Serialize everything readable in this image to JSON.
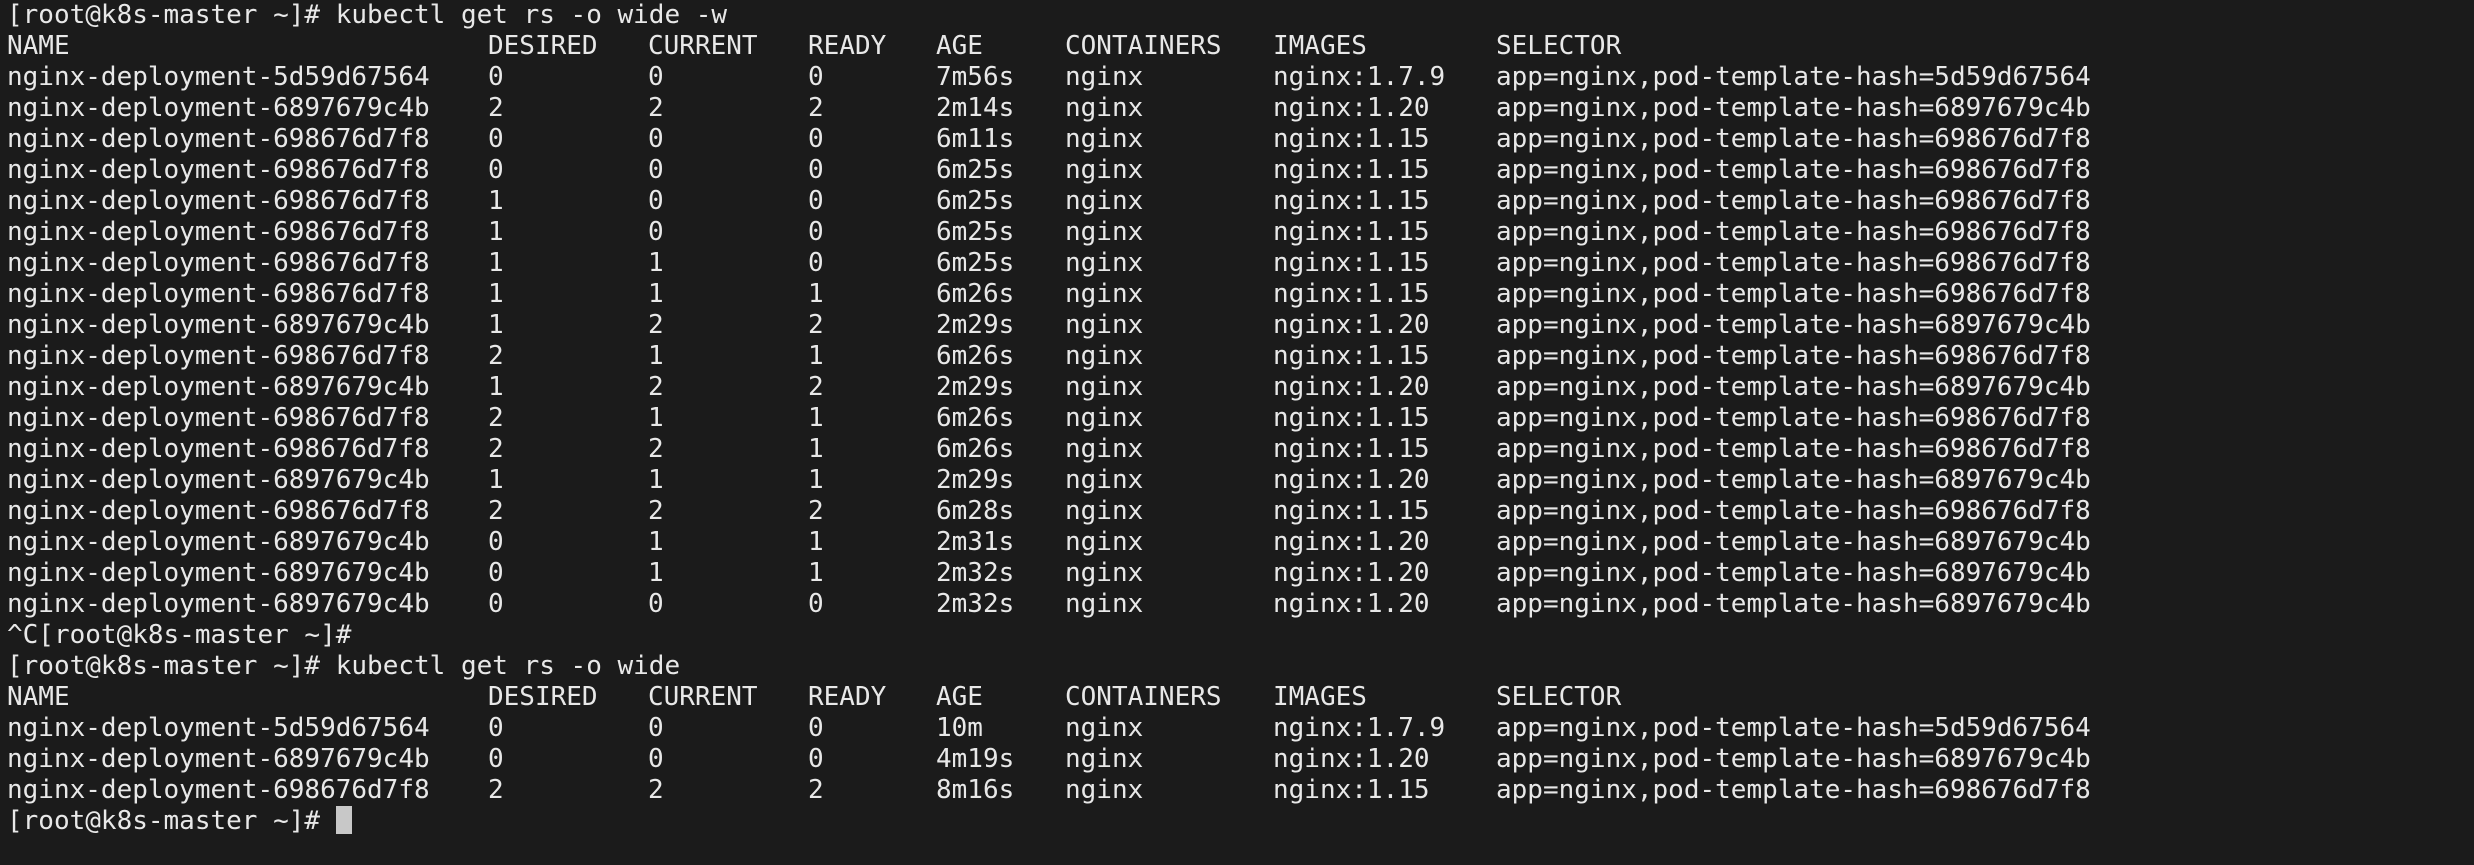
{
  "session1": {
    "prompt": "[root@k8s-master ~]# ",
    "command": "kubectl get rs -o wide -w",
    "headers": [
      "NAME",
      "DESIRED",
      "CURRENT",
      "READY",
      "AGE",
      "CONTAINERS",
      "IMAGES",
      "SELECTOR"
    ],
    "rows": [
      [
        "nginx-deployment-5d59d67564",
        "0",
        "0",
        "0",
        "7m56s",
        "nginx",
        "nginx:1.7.9",
        "app=nginx,pod-template-hash=5d59d67564"
      ],
      [
        "nginx-deployment-6897679c4b",
        "2",
        "2",
        "2",
        "2m14s",
        "nginx",
        "nginx:1.20",
        "app=nginx,pod-template-hash=6897679c4b"
      ],
      [
        "nginx-deployment-698676d7f8",
        "0",
        "0",
        "0",
        "6m11s",
        "nginx",
        "nginx:1.15",
        "app=nginx,pod-template-hash=698676d7f8"
      ],
      [
        "nginx-deployment-698676d7f8",
        "0",
        "0",
        "0",
        "6m25s",
        "nginx",
        "nginx:1.15",
        "app=nginx,pod-template-hash=698676d7f8"
      ],
      [
        "nginx-deployment-698676d7f8",
        "1",
        "0",
        "0",
        "6m25s",
        "nginx",
        "nginx:1.15",
        "app=nginx,pod-template-hash=698676d7f8"
      ],
      [
        "nginx-deployment-698676d7f8",
        "1",
        "0",
        "0",
        "6m25s",
        "nginx",
        "nginx:1.15",
        "app=nginx,pod-template-hash=698676d7f8"
      ],
      [
        "nginx-deployment-698676d7f8",
        "1",
        "1",
        "0",
        "6m25s",
        "nginx",
        "nginx:1.15",
        "app=nginx,pod-template-hash=698676d7f8"
      ],
      [
        "nginx-deployment-698676d7f8",
        "1",
        "1",
        "1",
        "6m26s",
        "nginx",
        "nginx:1.15",
        "app=nginx,pod-template-hash=698676d7f8"
      ],
      [
        "nginx-deployment-6897679c4b",
        "1",
        "2",
        "2",
        "2m29s",
        "nginx",
        "nginx:1.20",
        "app=nginx,pod-template-hash=6897679c4b"
      ],
      [
        "nginx-deployment-698676d7f8",
        "2",
        "1",
        "1",
        "6m26s",
        "nginx",
        "nginx:1.15",
        "app=nginx,pod-template-hash=698676d7f8"
      ],
      [
        "nginx-deployment-6897679c4b",
        "1",
        "2",
        "2",
        "2m29s",
        "nginx",
        "nginx:1.20",
        "app=nginx,pod-template-hash=6897679c4b"
      ],
      [
        "nginx-deployment-698676d7f8",
        "2",
        "1",
        "1",
        "6m26s",
        "nginx",
        "nginx:1.15",
        "app=nginx,pod-template-hash=698676d7f8"
      ],
      [
        "nginx-deployment-698676d7f8",
        "2",
        "2",
        "1",
        "6m26s",
        "nginx",
        "nginx:1.15",
        "app=nginx,pod-template-hash=698676d7f8"
      ],
      [
        "nginx-deployment-6897679c4b",
        "1",
        "1",
        "1",
        "2m29s",
        "nginx",
        "nginx:1.20",
        "app=nginx,pod-template-hash=6897679c4b"
      ],
      [
        "nginx-deployment-698676d7f8",
        "2",
        "2",
        "2",
        "6m28s",
        "nginx",
        "nginx:1.15",
        "app=nginx,pod-template-hash=698676d7f8"
      ],
      [
        "nginx-deployment-6897679c4b",
        "0",
        "1",
        "1",
        "2m31s",
        "nginx",
        "nginx:1.20",
        "app=nginx,pod-template-hash=6897679c4b"
      ],
      [
        "nginx-deployment-6897679c4b",
        "0",
        "1",
        "1",
        "2m32s",
        "nginx",
        "nginx:1.20",
        "app=nginx,pod-template-hash=6897679c4b"
      ],
      [
        "nginx-deployment-6897679c4b",
        "0",
        "0",
        "0",
        "2m32s",
        "nginx",
        "nginx:1.20",
        "app=nginx,pod-template-hash=6897679c4b"
      ]
    ]
  },
  "interrupt_line": "^C[root@k8s-master ~]#",
  "session2": {
    "prompt": "[root@k8s-master ~]# ",
    "command": "kubectl get rs -o wide",
    "headers": [
      "NAME",
      "DESIRED",
      "CURRENT",
      "READY",
      "AGE",
      "CONTAINERS",
      "IMAGES",
      "SELECTOR"
    ],
    "rows": [
      [
        "nginx-deployment-5d59d67564",
        "0",
        "0",
        "0",
        "10m",
        "nginx",
        "nginx:1.7.9",
        "app=nginx,pod-template-hash=5d59d67564"
      ],
      [
        "nginx-deployment-6897679c4b",
        "0",
        "0",
        "0",
        "4m19s",
        "nginx",
        "nginx:1.20",
        "app=nginx,pod-template-hash=6897679c4b"
      ],
      [
        "nginx-deployment-698676d7f8",
        "2",
        "2",
        "2",
        "8m16s",
        "nginx",
        "nginx:1.15",
        "app=nginx,pod-template-hash=698676d7f8"
      ]
    ]
  },
  "final_prompt": "[root@k8s-master ~]# ",
  "colors": {
    "background": "#1b1b1b",
    "foreground": "#e8e8e8",
    "cursor": "#c8c8c8"
  }
}
